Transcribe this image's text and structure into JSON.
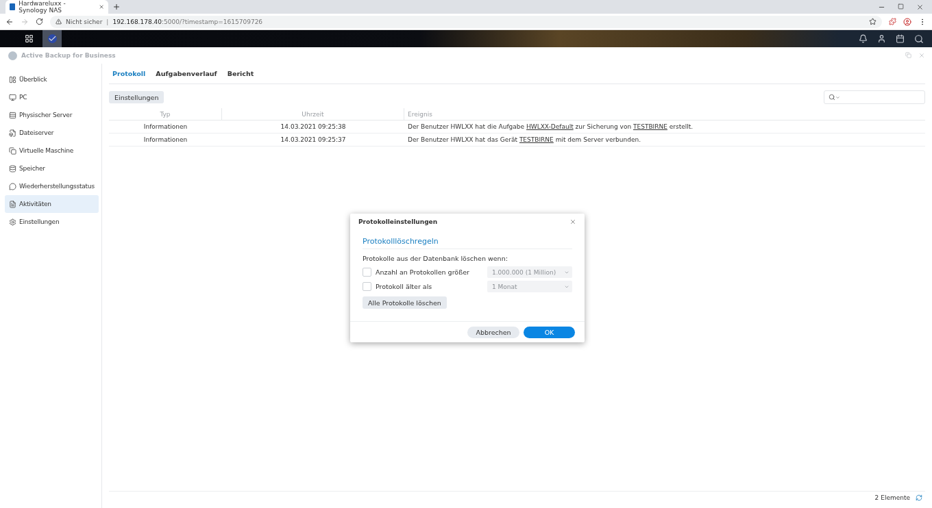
{
  "browser": {
    "tab_title": "Hardwareluxx - Synology NAS",
    "security": "Nicht sicher",
    "separator": "|",
    "url_host": "192.168.178.40",
    "url_rest": ":5000/?timestamp=1615709726"
  },
  "app": {
    "title": "Active Backup for Business"
  },
  "sidebar": {
    "items": [
      {
        "label": "Überblick",
        "selected": false
      },
      {
        "label": "PC",
        "selected": false
      },
      {
        "label": "Physischer Server",
        "selected": false
      },
      {
        "label": "Dateiserver",
        "selected": false
      },
      {
        "label": "Virtuelle Maschine",
        "selected": false
      },
      {
        "label": "Speicher",
        "selected": false
      },
      {
        "label": "Wiederherstellungsstatus",
        "selected": false
      },
      {
        "label": "Aktivitäten",
        "selected": true
      },
      {
        "label": "Einstellungen",
        "selected": false
      }
    ]
  },
  "tabs": [
    {
      "label": "Protokoll",
      "selected": true
    },
    {
      "label": "Aufgabenverlauf",
      "selected": false
    },
    {
      "label": "Bericht",
      "selected": false
    }
  ],
  "toolbar": {
    "button": "Einstellungen"
  },
  "table": {
    "columns": [
      "Typ",
      "Uhrzeit",
      "Ereignis"
    ],
    "rows": [
      {
        "type": "Informationen",
        "time": "14.03.2021 09:25:38",
        "event": [
          {
            "kind": "text",
            "text": "Der Benutzer HWLXX hat die Aufgabe "
          },
          {
            "kind": "link",
            "text": "HWLXX-Default"
          },
          {
            "kind": "text",
            "text": " zur Sicherung von "
          },
          {
            "kind": "link",
            "text": "TESTBIRNE"
          },
          {
            "kind": "text",
            "text": " erstellt."
          }
        ]
      },
      {
        "type": "Informationen",
        "time": "14.03.2021 09:25:37",
        "event": [
          {
            "kind": "text",
            "text": "Der Benutzer HWLXX hat das Gerät "
          },
          {
            "kind": "link",
            "text": "TESTBIRNE"
          },
          {
            "kind": "text",
            "text": " mit dem Server verbunden."
          }
        ]
      }
    ]
  },
  "status_bar": {
    "count": "2 Elemente"
  },
  "dialog": {
    "title": "Protokolleinstellungen",
    "section": "Protokolllöschregeln",
    "intro": "Protokolle aus der Datenbank löschen wenn:",
    "rules": [
      {
        "label": "Anzahl an Protokollen größer",
        "checked": false,
        "value": "1.000.000 (1 Million)",
        "disabled": true
      },
      {
        "label": "Protokoll älter als",
        "checked": false,
        "value": "1 Monat",
        "disabled": true
      }
    ],
    "clear_button": "Alle Protokolle löschen",
    "cancel": "Abbrechen",
    "ok": "OK"
  }
}
